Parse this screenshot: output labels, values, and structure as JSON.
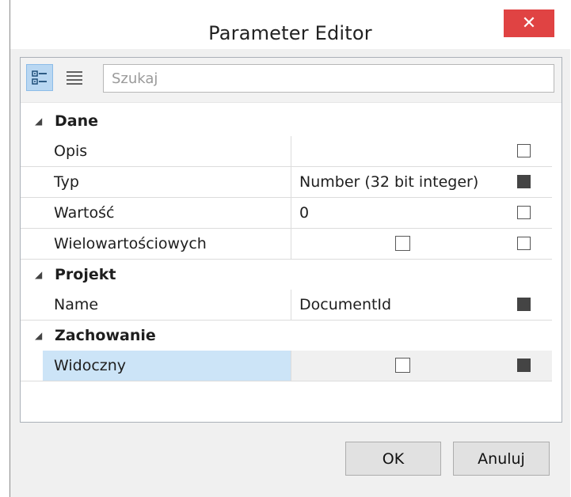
{
  "window": {
    "title": "Parameter Editor",
    "close_label": "✕"
  },
  "toolbar": {
    "search_placeholder": "Szukaj",
    "search_value": ""
  },
  "categories": [
    {
      "name": "Dane",
      "rows": [
        {
          "name": "Opis",
          "value": "",
          "value_checkbox": false,
          "marker": "empty"
        },
        {
          "name": "Typ",
          "value": "Number (32 bit integer)",
          "value_checkbox": false,
          "marker": "filled"
        },
        {
          "name": "Wartość",
          "value": "0",
          "value_checkbox": false,
          "marker": "empty"
        },
        {
          "name": "Wielowartościowych",
          "value": "",
          "value_checkbox": true,
          "checked": false,
          "marker": "empty"
        }
      ]
    },
    {
      "name": "Projekt",
      "rows": [
        {
          "name": "Name",
          "value": "DocumentId",
          "value_checkbox": false,
          "marker": "filled"
        }
      ]
    },
    {
      "name": "Zachowanie",
      "rows": [
        {
          "name": "Widoczny",
          "value": "",
          "value_checkbox": true,
          "checked": false,
          "marker": "filled",
          "selected": true
        }
      ]
    }
  ],
  "buttons": {
    "ok": "OK",
    "cancel": "Anuluj"
  },
  "colors": {
    "close_bg": "#e04343",
    "selected_row": "#cce4f7",
    "active_tool": "#b9d7f2"
  }
}
